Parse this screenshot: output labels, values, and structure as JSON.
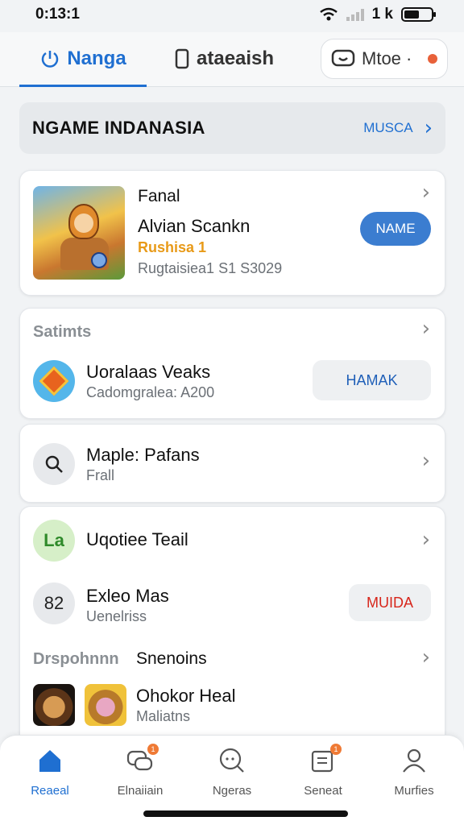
{
  "status": {
    "time": "0:13:1",
    "right_text": "1 k"
  },
  "tabs": [
    {
      "label": "Nanga",
      "icon": "power-icon"
    },
    {
      "label": "ataeaish",
      "icon": "phone-icon"
    },
    {
      "label": "Mtoe ·",
      "icon": "chat-icon"
    }
  ],
  "header": {
    "title": "NGAME INDANASIA",
    "link": "MUSCA"
  },
  "featured": {
    "label": "Fanal",
    "title": "Alvian Scankn",
    "highlight": "Rushisa 1",
    "subtitle": "Rugtaisiea1 S1 S3029",
    "button": "NAME"
  },
  "card2": {
    "section": "Satimts",
    "title": "Uoralaas Veaks",
    "subtitle": "Cadomgralea: A200",
    "button": "HAMAK"
  },
  "card3": {
    "title": "Maple: Pafans",
    "subtitle": "Frall"
  },
  "card4": {
    "item1_icon_text": "La",
    "item1_title": "Uqotiee Teail",
    "item2_icon_text": "82",
    "item2_title": "Exleo Mas",
    "item2_subtitle": "Uenelriss",
    "item2_button": "MUIDA",
    "section_a": "Drspohnnn",
    "section_b": "Snenoins",
    "item3_title": "Ohokor Heal",
    "item3_subtitle": "Maliatns"
  },
  "nav": [
    {
      "label": "Reaeal",
      "icon": "home-icon"
    },
    {
      "label": "Elnaiiain",
      "icon": "chat-bubbles-icon",
      "badge": "1"
    },
    {
      "label": "Ngeras",
      "icon": "search-chat-icon"
    },
    {
      "label": "Seneat",
      "icon": "news-icon",
      "badge": "1"
    },
    {
      "label": "Murfies",
      "icon": "profile-icon"
    }
  ],
  "colors": {
    "accent": "#1f6fd1",
    "orange": "#e89a18",
    "red": "#d7261b"
  }
}
